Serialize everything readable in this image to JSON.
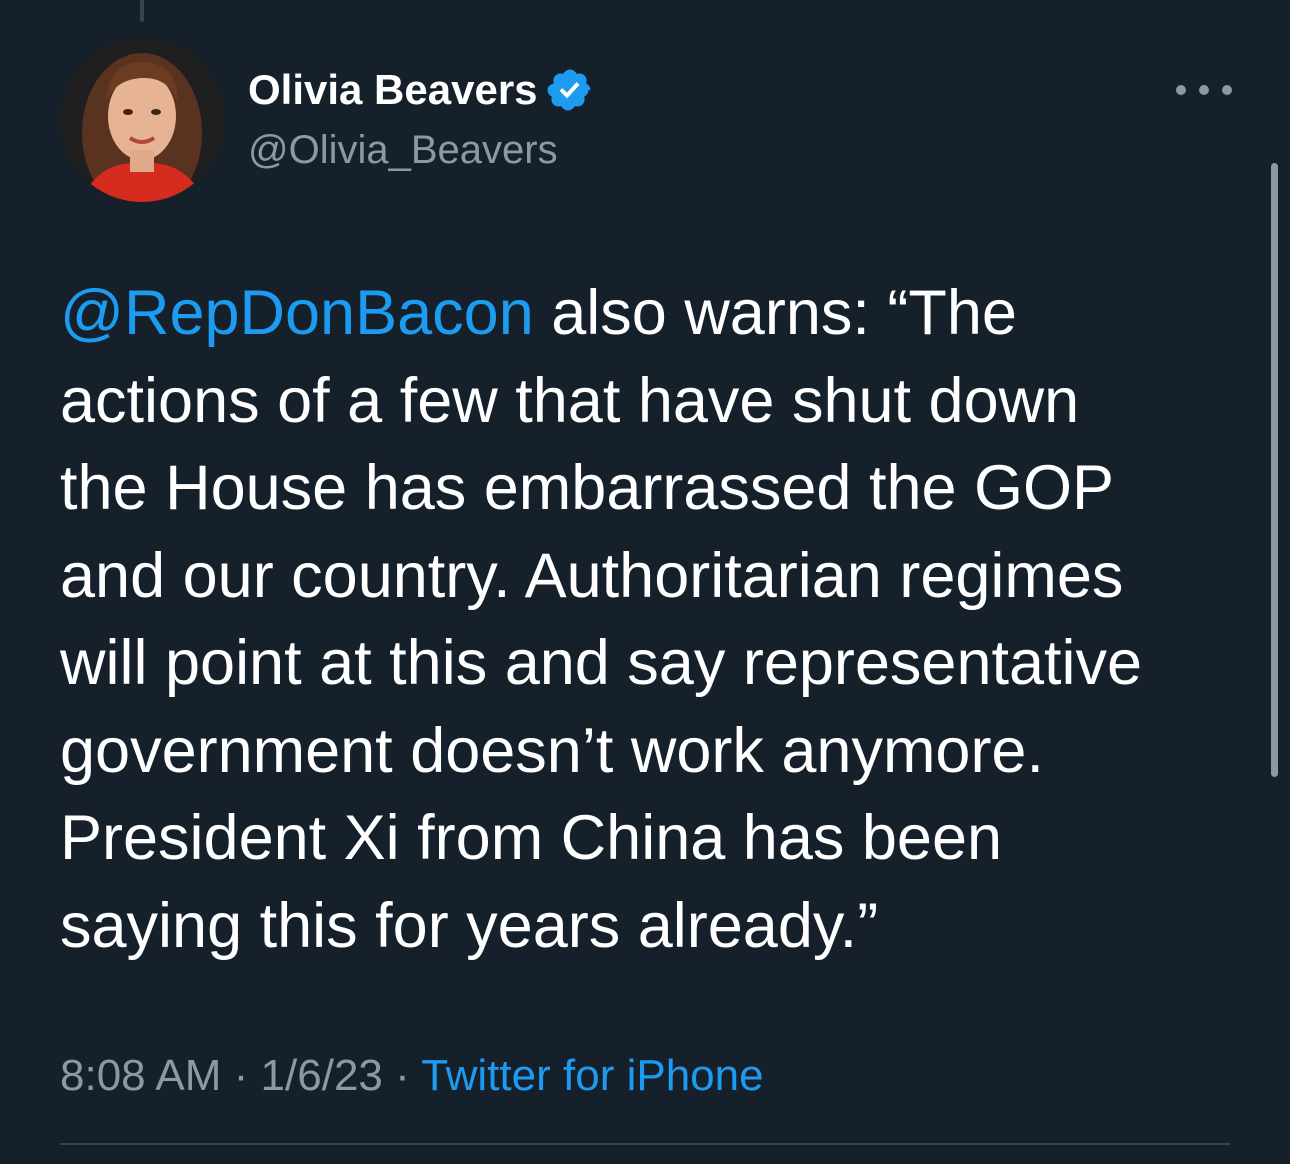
{
  "author": {
    "name": "Olivia Beavers",
    "handle": "@Olivia_Beavers",
    "verified": true
  },
  "tweet": {
    "mention": "@RepDonBacon",
    "lines": [
      " also warns: “The",
      "actions of a few that have shut down",
      "the House has embarrassed the GOP",
      "and our country. Authoritarian regimes",
      "will point at this and say representative",
      "government doesn’t work anymore.",
      "President Xi from China has been",
      "saying this for years already.”"
    ]
  },
  "meta": {
    "time": "8:08 AM",
    "separator": " · ",
    "date": "1/6/23",
    "source": "Twitter for iPhone"
  },
  "icons": {
    "verified": "verified-badge-icon",
    "more": "more-horizontal-icon"
  },
  "colors": {
    "background": "#15202b",
    "link": "#1d9bf0",
    "secondary_text": "#8b98a5",
    "divider": "#38444d"
  }
}
